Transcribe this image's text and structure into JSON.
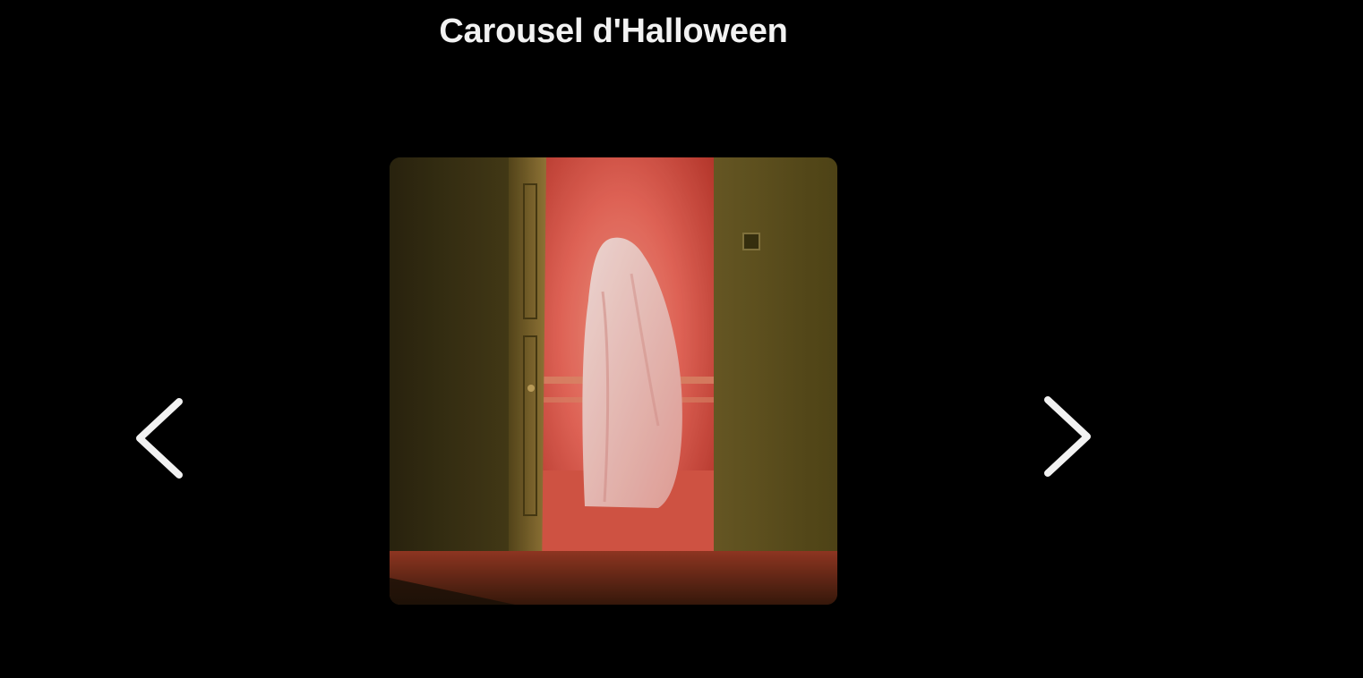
{
  "carousel": {
    "title": "Carousel d'Halloween",
    "prev_icon": "chevron-left-icon",
    "next_icon": "chevron-right-icon",
    "current_slide": {
      "subject": "ghost-in-doorway-image"
    }
  },
  "colors": {
    "background": "#000000",
    "title": "#f2f2f2",
    "arrow": "#f2f2f2",
    "room_glow": "#f06a5c",
    "wall": "#6b5a22"
  }
}
